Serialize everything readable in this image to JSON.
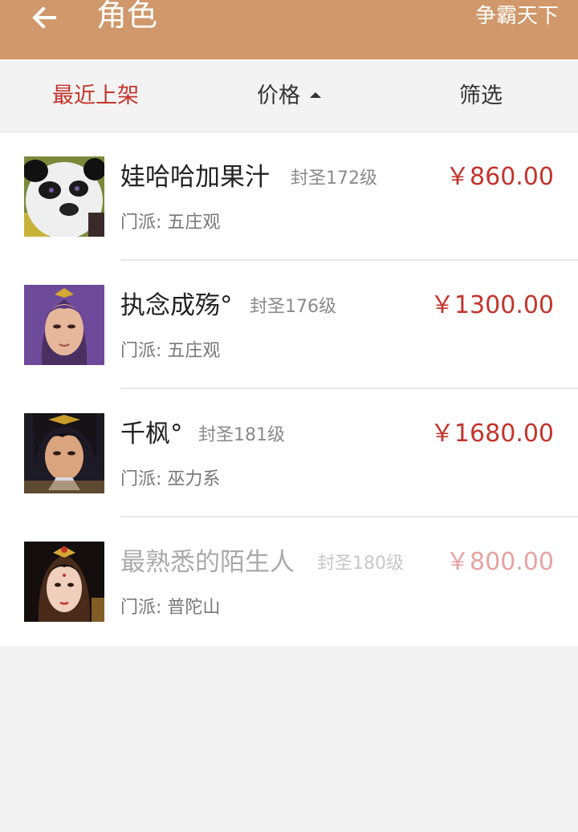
{
  "header": {
    "back_icon": "back-arrow-icon",
    "title": "角色",
    "server": "争霸天下",
    "background": "#d0986b"
  },
  "sort_bar": {
    "recent": "最近上架",
    "price": "价格",
    "price_sort_icon": "caret-up-icon",
    "filter": "筛选",
    "active_color": "#c4342b"
  },
  "characters": [
    {
      "avatar": "panda-portrait",
      "name": "娃哈哈加果汁",
      "level": "封圣172级",
      "price": "￥860.00",
      "sect": "门派: 五庄观",
      "faded": false
    },
    {
      "avatar": "purple-haired-warrior-portrait",
      "name": "执念成殇°",
      "level": "封圣176级",
      "price": "￥1300.00",
      "sect": "门派: 五庄观",
      "faded": false
    },
    {
      "avatar": "dark-haired-warrior-portrait",
      "name": "千枫°",
      "level": "封圣181级",
      "price": "￥1680.00",
      "sect": "门派: 巫力系",
      "faded": false
    },
    {
      "avatar": "female-portrait",
      "name": "最熟悉的陌生人",
      "level": "封圣180级",
      "price": "￥800.00",
      "sect": "门派: 普陀山",
      "faded": true
    }
  ],
  "colors": {
    "price": "#c4342b",
    "list_bg": "#ffffff",
    "page_bg": "#f3f3f3"
  }
}
